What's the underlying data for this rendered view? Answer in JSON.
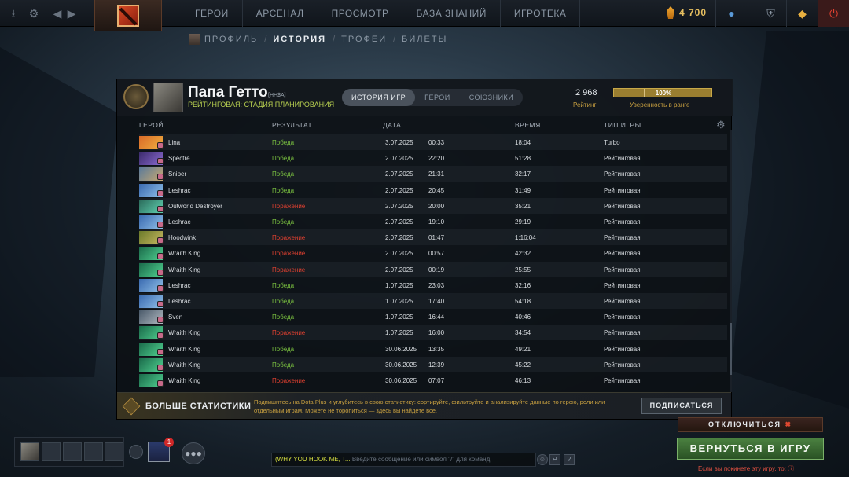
{
  "topbar": {
    "nav": [
      "ГЕРОИ",
      "АРСЕНАЛ",
      "ПРОСМОТР",
      "БАЗА ЗНАНИЙ",
      "ИГРОТЕКА"
    ],
    "shards": "4 700"
  },
  "subnav": {
    "items": [
      "ПРОФИЛЬ",
      "ИСТОРИЯ",
      "ТРОФЕИ",
      "БИЛЕТЫ"
    ]
  },
  "profile": {
    "name": "Папа Гетто",
    "tag": "[НН$A]",
    "status": "РЕЙТИНГОВАЯ: СТАДИЯ ПЛАНИРОВАНИЯ",
    "tabs": [
      "ИСТОРИЯ ИГР",
      "ГЕРОИ",
      "СОЮЗНИКИ"
    ],
    "rating": "2 968",
    "rating_label": "Рейтинг",
    "confidence": "100%",
    "confidence_label": "Уверенность в ранге"
  },
  "table": {
    "headers": [
      "ГЕРОЙ",
      "РЕЗУЛЬТАТ",
      "ДАТА",
      "ВРЕМЯ",
      "ТИП ИГРЫ"
    ],
    "rows": [
      {
        "hero": "Lina",
        "result": "Победа",
        "win": true,
        "date": "3.07.2025",
        "time": "00:33",
        "duration": "18:04",
        "mode": "Turbo",
        "c1": "#d86a28",
        "c2": "#f0b040"
      },
      {
        "hero": "Spectre",
        "result": "Победа",
        "win": true,
        "date": "2.07.2025",
        "time": "22:20",
        "duration": "51:28",
        "mode": "Рейтинговая",
        "c1": "#3a2a6a",
        "c2": "#8a6ad0"
      },
      {
        "hero": "Sniper",
        "result": "Победа",
        "win": true,
        "date": "2.07.2025",
        "time": "21:31",
        "duration": "32:17",
        "mode": "Рейтинговая",
        "c1": "#5a7a9a",
        "c2": "#c8a870"
      },
      {
        "hero": "Leshrac",
        "result": "Победа",
        "win": true,
        "date": "2.07.2025",
        "time": "20:45",
        "duration": "31:49",
        "mode": "Рейтинговая",
        "c1": "#3a6ab0",
        "c2": "#90c0e8"
      },
      {
        "hero": "Outworld Destroyer",
        "result": "Поражение",
        "win": false,
        "date": "2.07.2025",
        "time": "20:00",
        "duration": "35:21",
        "mode": "Рейтинговая",
        "c1": "#2a6a5a",
        "c2": "#60d0b0"
      },
      {
        "hero": "Leshrac",
        "result": "Победа",
        "win": true,
        "date": "2.07.2025",
        "time": "19:10",
        "duration": "29:19",
        "mode": "Рейтинговая",
        "c1": "#3a6ab0",
        "c2": "#90c0e8"
      },
      {
        "hero": "Hoodwink",
        "result": "Поражение",
        "win": false,
        "date": "2.07.2025",
        "time": "01:47",
        "duration": "1:16:04",
        "mode": "Рейтинговая",
        "c1": "#6a7a2a",
        "c2": "#c8b860"
      },
      {
        "hero": "Wraith King",
        "result": "Поражение",
        "win": false,
        "date": "2.07.2025",
        "time": "00:57",
        "duration": "42:32",
        "mode": "Рейтинговая",
        "c1": "#1a6a4a",
        "c2": "#50d090"
      },
      {
        "hero": "Wraith King",
        "result": "Поражение",
        "win": false,
        "date": "2.07.2025",
        "time": "00:19",
        "duration": "25:55",
        "mode": "Рейтинговая",
        "c1": "#1a6a4a",
        "c2": "#50d090"
      },
      {
        "hero": "Leshrac",
        "result": "Победа",
        "win": true,
        "date": "1.07.2025",
        "time": "23:03",
        "duration": "32:16",
        "mode": "Рейтинговая",
        "c1": "#3a6ab0",
        "c2": "#90c0e8"
      },
      {
        "hero": "Leshrac",
        "result": "Победа",
        "win": true,
        "date": "1.07.2025",
        "time": "17:40",
        "duration": "54:18",
        "mode": "Рейтинговая",
        "c1": "#3a6ab0",
        "c2": "#90c0e8"
      },
      {
        "hero": "Sven",
        "result": "Победа",
        "win": true,
        "date": "1.07.2025",
        "time": "16:44",
        "duration": "40:46",
        "mode": "Рейтинговая",
        "c1": "#4a5a6a",
        "c2": "#b0b8c0"
      },
      {
        "hero": "Wraith King",
        "result": "Поражение",
        "win": false,
        "date": "1.07.2025",
        "time": "16:00",
        "duration": "34:54",
        "mode": "Рейтинговая",
        "c1": "#1a6a4a",
        "c2": "#50d090"
      },
      {
        "hero": "Wraith King",
        "result": "Победа",
        "win": true,
        "date": "30.06.2025",
        "time": "13:35",
        "duration": "49:21",
        "mode": "Рейтинговая",
        "c1": "#1a6a4a",
        "c2": "#50d090"
      },
      {
        "hero": "Wraith King",
        "result": "Победа",
        "win": true,
        "date": "30.06.2025",
        "time": "12:39",
        "duration": "45:22",
        "mode": "Рейтинговая",
        "c1": "#1a6a4a",
        "c2": "#50d090"
      },
      {
        "hero": "Wraith King",
        "result": "Поражение",
        "win": false,
        "date": "30.06.2025",
        "time": "07:07",
        "duration": "46:13",
        "mode": "Рейтинговая",
        "c1": "#1a6a4a",
        "c2": "#50d090"
      }
    ]
  },
  "promo": {
    "title": "БОЛЬШЕ СТАТИСТИКИ",
    "description": "Подпишитесь на Dota Plus и углубитесь в свою статистику: сортируйте, фильтруйте и анализируйте данные по герою, роли или отдельным играм. Можете не торопиться — здесь вы найдёте всё.",
    "button": "ПОДПИСАТЬСЯ"
  },
  "bottom": {
    "notification_count": "1",
    "chat_channel": "(WHY YOU HOOK ME, T...",
    "chat_placeholder": "Введите сообщение или символ \"/\" для команд.",
    "disconnect": "ОТКЛЮЧИТЬСЯ",
    "return": "ВЕРНУТЬСЯ В ИГРУ",
    "leave_warning": "Если вы покинете эту игру, то:"
  },
  "colors": {
    "win": "#7ac040",
    "loss": "#e04030",
    "gold": "#c8a040",
    "return_green": "#4a8040"
  }
}
